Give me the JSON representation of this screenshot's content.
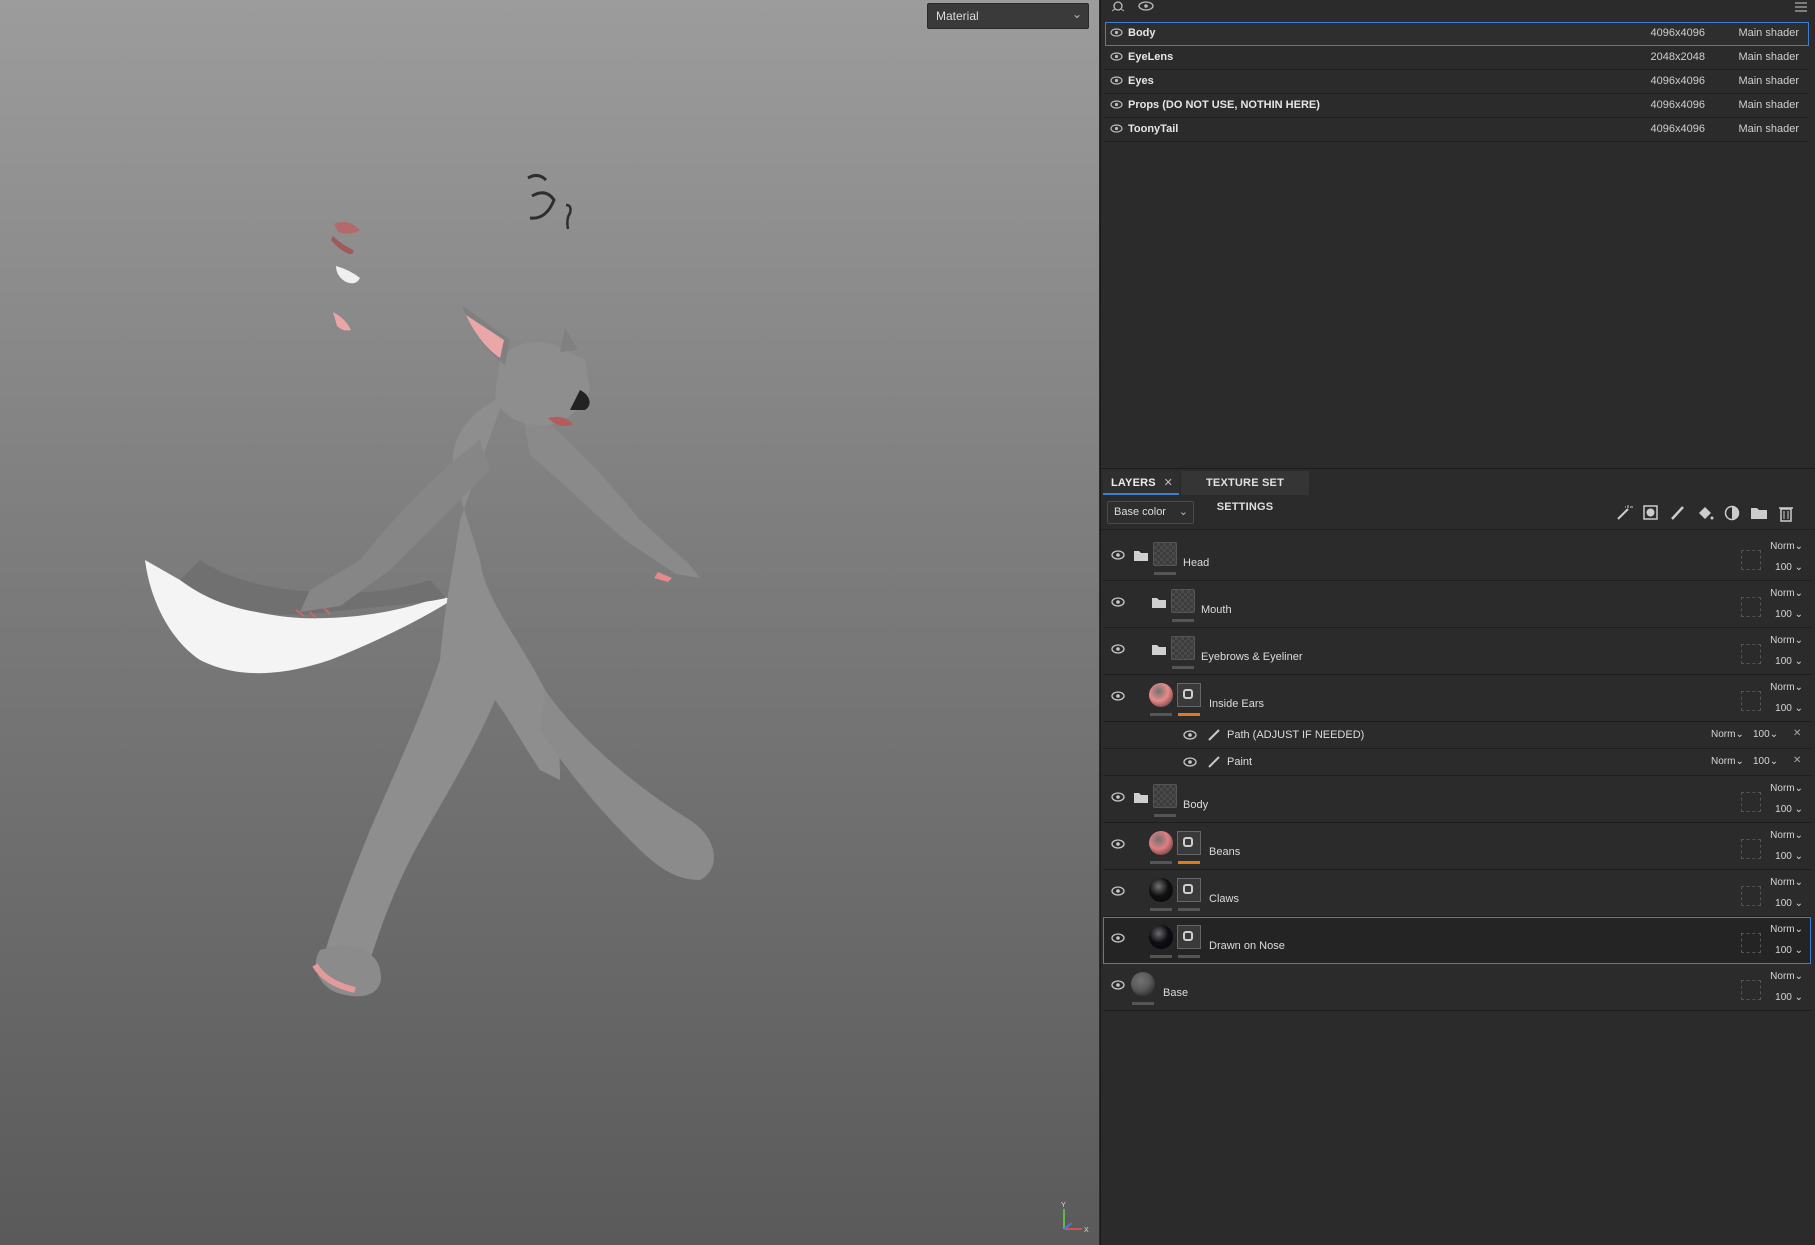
{
  "viewport": {
    "mode_select": {
      "value": "Material",
      "icon": "chevron-down-icon"
    },
    "axis_gizmo": {
      "y_label": "Y",
      "x_label": "X"
    }
  },
  "texture_sets": {
    "rows": [
      {
        "name": "Body",
        "resolution": "4096x4096",
        "shader": "Main shader",
        "selected": true
      },
      {
        "name": "EyeLens",
        "resolution": "2048x2048",
        "shader": "Main shader",
        "selected": false
      },
      {
        "name": "Eyes",
        "resolution": "4096x4096",
        "shader": "Main shader",
        "selected": false
      },
      {
        "name": "Props (DO NOT USE, NOTHIN HERE)",
        "resolution": "4096x4096",
        "shader": "Main shader",
        "selected": false
      },
      {
        "name": "ToonyTail",
        "resolution": "4096x4096",
        "shader": "Main shader",
        "selected": false
      }
    ]
  },
  "layers_panel": {
    "tab_layers": "LAYERS",
    "tab_texture_set_settings": "TEXTURE SET SETTINGS",
    "channel_select": "Base color",
    "toolbar_icons": [
      "magic-wand-icon",
      "add-mask-icon",
      "brush-icon",
      "fill-bucket-icon",
      "effect-icon",
      "folder-icon",
      "trash-icon"
    ],
    "layers": [
      {
        "name": "Head",
        "type": "folder-open",
        "blend": "Norm",
        "opacity": "100"
      },
      {
        "name": "Mouth",
        "type": "folder",
        "blend": "Norm",
        "opacity": "100"
      },
      {
        "name": "Eyebrows & Eyeliner",
        "type": "folder",
        "blend": "Norm",
        "opacity": "100"
      },
      {
        "name": "Inside Ears",
        "type": "fill-mask",
        "blend": "Norm",
        "opacity": "100",
        "color": "#e88a8a",
        "sublayers": [
          {
            "name": "Path (ADJUST IF NEEDED)",
            "blend": "Norm",
            "opacity": "100"
          },
          {
            "name": "Paint",
            "blend": "Norm",
            "opacity": "100"
          }
        ]
      },
      {
        "name": "Body",
        "type": "folder-open",
        "blend": "Norm",
        "opacity": "100"
      },
      {
        "name": "Beans",
        "type": "fill-mask",
        "blend": "Norm",
        "opacity": "100",
        "color": "#e07f82"
      },
      {
        "name": "Claws",
        "type": "fill-mask",
        "blend": "Norm",
        "opacity": "100",
        "color": "#111111"
      },
      {
        "name": "Drawn on Nose",
        "type": "fill-mask",
        "blend": "Norm",
        "opacity": "100",
        "color": "#0d0d14",
        "selected": true
      },
      {
        "name": "Base",
        "type": "fill",
        "blend": "Norm",
        "opacity": "100",
        "color": "#5a5a5a"
      }
    ]
  },
  "colors": {
    "accent": "#3d7fd6",
    "mask_indicator": "#e07a1a"
  }
}
